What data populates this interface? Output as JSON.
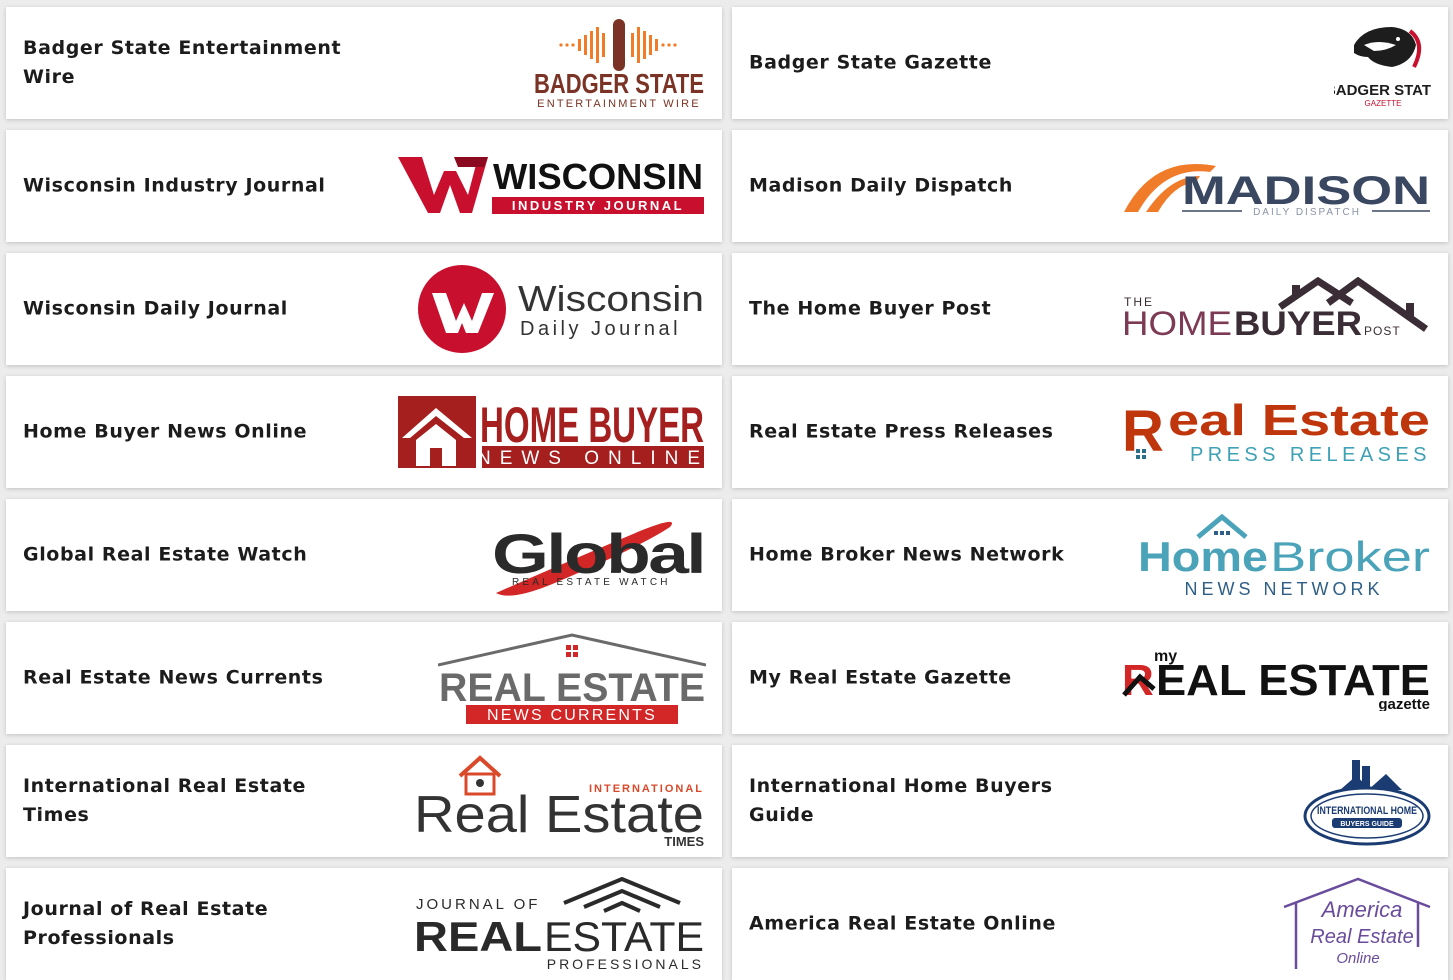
{
  "cards": [
    {
      "title": "Badger State Entertainment Wire",
      "logo": {
        "line1": "BADGER STATE",
        "line2": "ENTERTAINMENT WIRE"
      }
    },
    {
      "title": "Badger State Gazette",
      "logo": {
        "line1": "BADGER STATE",
        "line2": "GAZETTE"
      }
    },
    {
      "title": "Wisconsin Industry Journal",
      "logo": {
        "line1": "WISCONSIN",
        "line2": "INDUSTRY JOURNAL"
      }
    },
    {
      "title": "Madison Daily Dispatch",
      "logo": {
        "line1": "MADISON",
        "line2": "DAILY DISPATCH"
      }
    },
    {
      "title": "Wisconsin Daily Journal",
      "logo": {
        "line1": "Wisconsin",
        "line2": "Daily Journal"
      }
    },
    {
      "title": "The Home Buyer Post",
      "logo": {
        "line0": "THE",
        "line1a": "HOME",
        "line1b": "BUYER",
        "line2": "POST"
      }
    },
    {
      "title": "Home Buyer News Online",
      "logo": {
        "line1": "HOME BUYER",
        "line2": "NEWS ONLINE"
      }
    },
    {
      "title": "Real Estate Press Releases",
      "logo": {
        "line1": "eal Estate",
        "mark": "R",
        "line2": "PRESS RELEASES"
      }
    },
    {
      "title": "Global Real Estate Watch",
      "logo": {
        "line1": "Global",
        "line2": "REAL ESTATE WATCH"
      }
    },
    {
      "title": "Home Broker News Network",
      "logo": {
        "line1a": "Home",
        "line1b": "Broker",
        "line2": "NEWS NETWORK"
      }
    },
    {
      "title": "Real Estate News Currents",
      "logo": {
        "line1": "REAL ESTATE",
        "line2": "NEWS CURRENTS"
      }
    },
    {
      "title": "My Real Estate Gazette",
      "logo": {
        "line0": "my",
        "mark": "R",
        "line1": "EAL ESTATE",
        "line2": "gazette"
      }
    },
    {
      "title": "International Real Estate Times",
      "logo": {
        "line0": "INTERNATIONAL",
        "line1": "Real Estate",
        "line2": "TIMES"
      }
    },
    {
      "title": "International Home Buyers Guide",
      "logo": {
        "line1": "INTERNATIONAL HOME",
        "line2": "BUYERS GUIDE"
      }
    },
    {
      "title": "Journal of Real Estate Professionals",
      "logo": {
        "line0": "JOURNAL OF",
        "line1a": "REAL",
        "line1b": "ESTATE",
        "line2": "PROFESSIONALS"
      }
    },
    {
      "title": "America Real Estate Online",
      "logo": {
        "line0": "America",
        "line1": "Real Estate",
        "line2": "Online"
      }
    }
  ],
  "colors": {
    "orange": "#f07c2a",
    "brown": "#7a3324",
    "red": "#c8102e",
    "navy": "#3a4760",
    "teal": "#4aa3b9",
    "purple": "#6a4c9c",
    "dark": "#2a2a2a"
  }
}
